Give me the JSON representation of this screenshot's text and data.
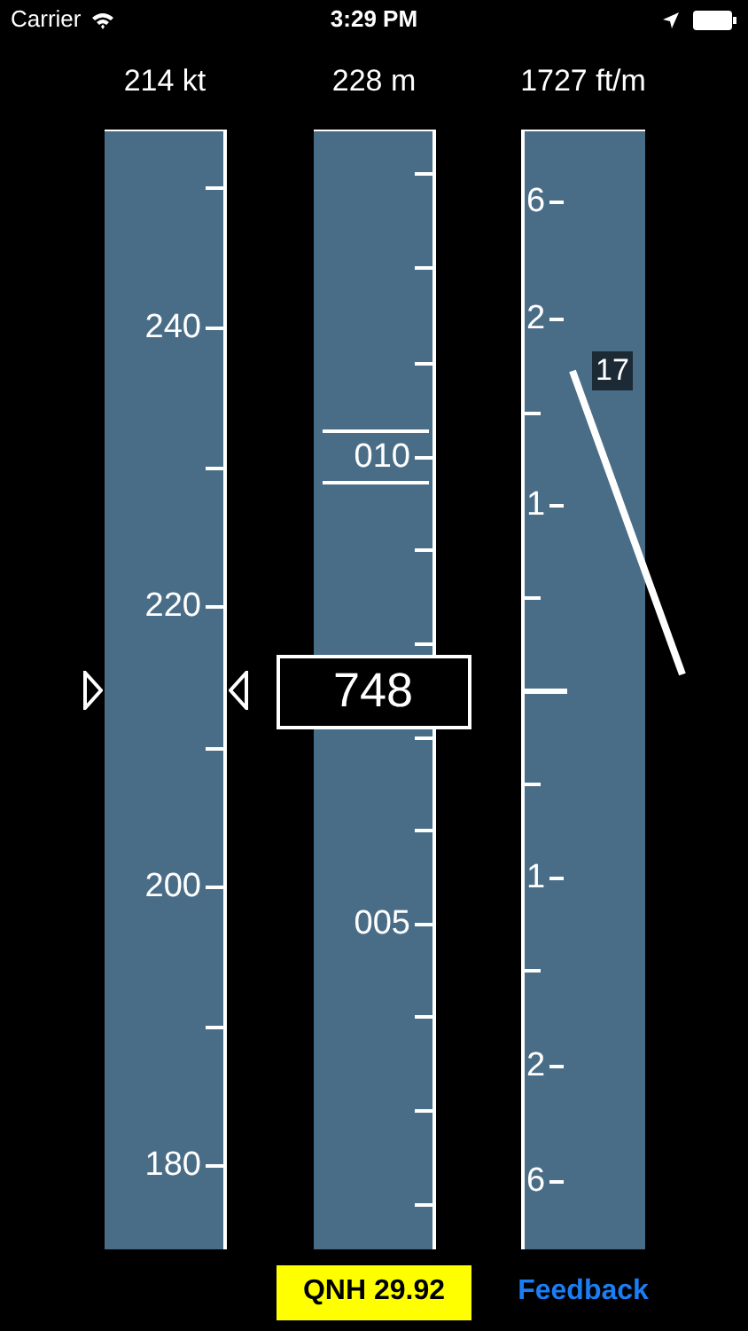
{
  "status_bar": {
    "carrier": "Carrier",
    "time": "3:29 PM"
  },
  "readouts": [
    "214 kt",
    "228 m",
    "1727 ft/m"
  ],
  "speed_tape": {
    "labels": [
      "240",
      "220",
      "200",
      "180"
    ]
  },
  "altitude_tape": {
    "labels": [
      "010",
      "005"
    ],
    "current": "748"
  },
  "vertical_speed_tape": {
    "labels": [
      "6",
      "2",
      "1",
      "1",
      "2",
      "6"
    ],
    "needle_value": "17"
  },
  "qnh_button": "QNH 29.92",
  "feedback_link": "Feedback"
}
